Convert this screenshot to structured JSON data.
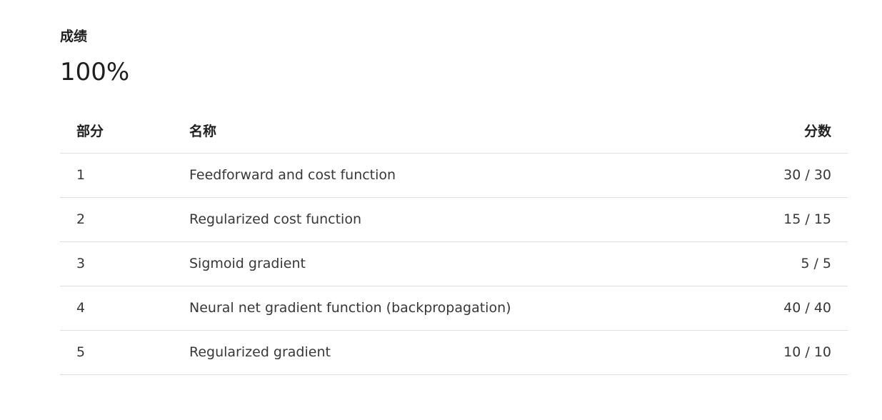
{
  "grade": {
    "label": "成绩",
    "value": "100%"
  },
  "table": {
    "headers": {
      "part": "部分",
      "name": "名称",
      "score": "分数"
    },
    "rows": [
      {
        "part": "1",
        "name": "Feedforward and cost function",
        "score": "30 / 30"
      },
      {
        "part": "2",
        "name": "Regularized cost function",
        "score": "15 / 15"
      },
      {
        "part": "3",
        "name": "Sigmoid gradient",
        "score": "5 / 5"
      },
      {
        "part": "4",
        "name": "Neural net gradient function (backpropagation)",
        "score": "40 / 40"
      },
      {
        "part": "5",
        "name": "Regularized gradient",
        "score": "10 / 10"
      }
    ]
  }
}
